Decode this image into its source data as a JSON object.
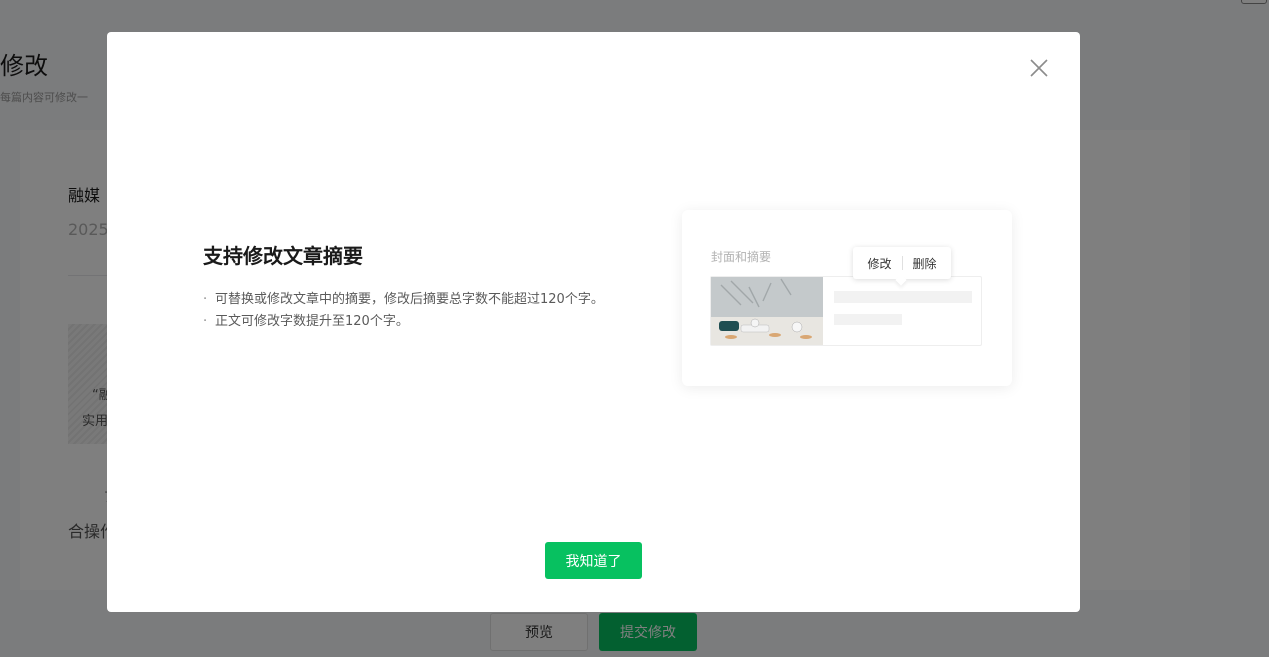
{
  "background": {
    "page_title": "修改",
    "page_subtitle": "每篇内容可修改一",
    "article_title": "融媒",
    "article_date": "2025",
    "hatched_line1": "“融",
    "hatched_line2": "实用",
    "partial_text1": "7",
    "partial_text2": "合操作",
    "preview_label": "预览",
    "submit_label": "提交修改"
  },
  "dialog": {
    "title": "支持修改文章摘要",
    "points": [
      "可替换或修改文章中的摘要，修改后摘要总字数不能超过120个字。",
      "正文可修改字数提升至120个字。"
    ],
    "illustration": {
      "label": "封面和摘要",
      "edit_label": "修改",
      "delete_label": "删除"
    },
    "confirm_label": "我知道了"
  },
  "colors": {
    "brand_green": "#07c160",
    "overlay": "rgba(0,0,0,0.5)"
  }
}
